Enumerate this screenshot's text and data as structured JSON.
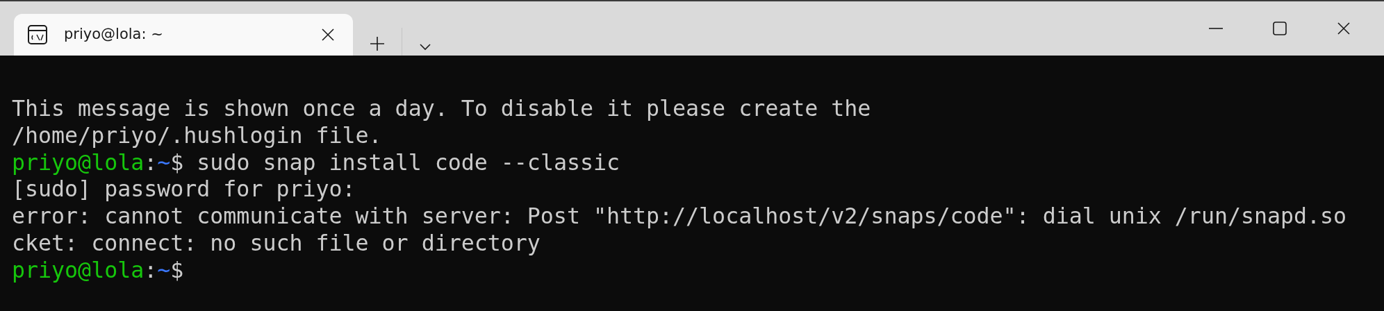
{
  "tabs": [
    {
      "title": "priyo@lola: ~",
      "selected": true
    }
  ],
  "terminal": {
    "lines": [
      {
        "kind": "output",
        "text": "This message is shown once a day. To disable it please create the"
      },
      {
        "kind": "output",
        "text": "/home/priyo/.hushlogin file."
      },
      {
        "kind": "prompt",
        "user_host": "priyo@lola",
        "separator": ":",
        "path": "~",
        "symbol": "$",
        "command": "sudo snap install code --classic"
      },
      {
        "kind": "output",
        "text": "[sudo] password for priyo:"
      },
      {
        "kind": "output",
        "text": "error: cannot communicate with server: Post \"http://localhost/v2/snaps/code\": dial unix /run/snapd.so"
      },
      {
        "kind": "output",
        "text": "cket: connect: no such file or directory"
      },
      {
        "kind": "prompt",
        "user_host": "priyo@lola",
        "separator": ":",
        "path": "~",
        "symbol": "$"
      }
    ]
  }
}
